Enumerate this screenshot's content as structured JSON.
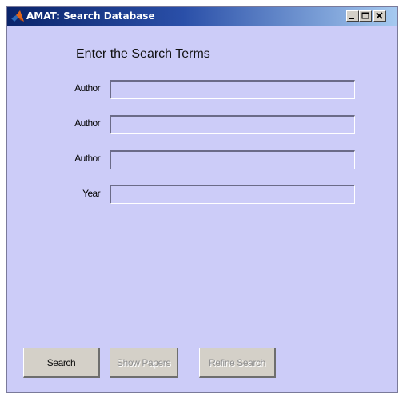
{
  "window": {
    "title": "AMAT: Search Database",
    "background_color": "#ccccf8",
    "titlebar_color": "#0a246a"
  },
  "form": {
    "heading": "Enter the Search Terms",
    "fields": [
      {
        "label": "Author",
        "value": ""
      },
      {
        "label": "Author",
        "value": ""
      },
      {
        "label": "Author",
        "value": ""
      },
      {
        "label": "Year",
        "value": ""
      }
    ]
  },
  "buttons": {
    "search": {
      "label": "Search",
      "enabled": true
    },
    "show_papers": {
      "label": "Show Papers",
      "enabled": false
    },
    "refine_search": {
      "label": "Refine Search",
      "enabled": false
    }
  },
  "icons": {
    "app": "matlab-logo-icon",
    "minimize": "minimize-icon",
    "maximize": "maximize-icon",
    "close": "close-icon"
  }
}
